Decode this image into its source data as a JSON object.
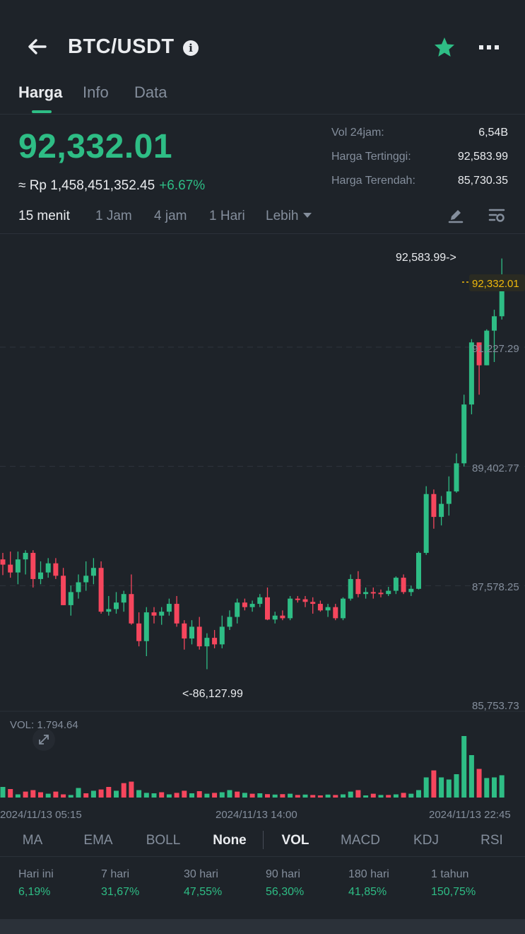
{
  "header": {
    "pair": "BTC/USDT",
    "info_glyph": "i",
    "icons": [
      "back-arrow-icon",
      "info-icon",
      "favorite-star-icon",
      "more-icon"
    ]
  },
  "tabs": [
    {
      "label": "Harga",
      "active": true
    },
    {
      "label": "Info",
      "active": false
    },
    {
      "label": "Data",
      "active": false
    }
  ],
  "ticker": {
    "last_price": "92,332.01",
    "fiat_value": "≈ Rp 1,458,451,352.45",
    "change_pct": "+6.67%",
    "stats": [
      {
        "label": "Vol 24jam:",
        "value": "6,54B"
      },
      {
        "label": "Harga Tertinggi:",
        "value": "92,583.99"
      },
      {
        "label": "Harga Terendah:",
        "value": "85,730.35"
      }
    ]
  },
  "intervals": [
    "15 menit",
    "1 Jam",
    "4 jam",
    "1 Hari",
    "Lebih"
  ],
  "active_interval": "15 menit",
  "chart_data": {
    "type": "candlestick",
    "interval": "15 menit",
    "y_ticks": [
      "91,227.29",
      "89,402.77",
      "87,578.25",
      "85,753.73"
    ],
    "ylim": [
      85753.73,
      92583.99
    ],
    "current_price_label": "92,332.01",
    "high_marker": "92,583.99->",
    "low_marker": "<-86,127.99",
    "volume_label": "VOL: 1,794.64",
    "x_ticks": [
      "2024/11/13 05:15",
      "2024/11/13 14:00",
      "2024/11/13 22:45"
    ],
    "colors": {
      "up": "#2ebd85",
      "down": "#f6465d",
      "current": "#f0b90b"
    },
    "candles": [
      [
        87980,
        88080,
        87740,
        87900
      ],
      [
        87900,
        88100,
        87700,
        87780
      ],
      [
        87780,
        88100,
        87600,
        87980
      ],
      [
        87980,
        88120,
        87750,
        88080
      ],
      [
        88080,
        88120,
        87550,
        87680
      ],
      [
        87680,
        87950,
        87600,
        87780
      ],
      [
        87780,
        88000,
        87700,
        87920
      ],
      [
        87920,
        88000,
        87680,
        87730
      ],
      [
        87730,
        87850,
        87280,
        87280
      ],
      [
        87280,
        87580,
        87120,
        87480
      ],
      [
        87480,
        87750,
        87380,
        87630
      ],
      [
        87630,
        87950,
        87500,
        87730
      ],
      [
        87730,
        88000,
        87600,
        87850
      ],
      [
        87850,
        87950,
        87150,
        87180
      ],
      [
        87180,
        87420,
        87120,
        87220
      ],
      [
        87220,
        87480,
        87150,
        87320
      ],
      [
        87320,
        87500,
        87180,
        87450
      ],
      [
        87450,
        87750,
        86980,
        87000
      ],
      [
        87000,
        87170,
        86650,
        86730
      ],
      [
        86730,
        87250,
        86500,
        87170
      ],
      [
        87170,
        87250,
        87000,
        87120
      ],
      [
        87120,
        87250,
        86980,
        87180
      ],
      [
        87180,
        87380,
        87120,
        87300
      ],
      [
        87300,
        87420,
        86950,
        87000
      ],
      [
        87000,
        87050,
        86600,
        86770
      ],
      [
        86770,
        87050,
        86680,
        86950
      ],
      [
        86950,
        87100,
        86600,
        86650
      ],
      [
        86650,
        86850,
        86300,
        86780
      ],
      [
        86780,
        86900,
        86620,
        86680
      ],
      [
        86680,
        87120,
        86620,
        86950
      ],
      [
        86950,
        87200,
        86900,
        87100
      ],
      [
        87100,
        87380,
        87000,
        87320
      ],
      [
        87320,
        87380,
        87200,
        87250
      ],
      [
        87250,
        87350,
        87180,
        87300
      ],
      [
        87300,
        87450,
        87250,
        87400
      ],
      [
        87400,
        87550,
        87050,
        87060
      ],
      [
        87060,
        87180,
        87000,
        87120
      ],
      [
        87120,
        87200,
        87050,
        87080
      ],
      [
        87080,
        87420,
        87050,
        87380
      ],
      [
        87380,
        87420,
        87320,
        87370
      ],
      [
        87370,
        87420,
        87250,
        87330
      ],
      [
        87330,
        87400,
        87150,
        87300
      ],
      [
        87300,
        87350,
        87180,
        87200
      ],
      [
        87200,
        87300,
        87100,
        87250
      ],
      [
        87250,
        87300,
        87050,
        87080
      ],
      [
        87080,
        87400,
        87050,
        87380
      ],
      [
        87380,
        87750,
        87350,
        87680
      ],
      [
        87680,
        87800,
        87400,
        87450
      ],
      [
        87450,
        87550,
        87380,
        87480
      ],
      [
        87480,
        87550,
        87380,
        87470
      ],
      [
        87470,
        87520,
        87400,
        87450
      ],
      [
        87450,
        87560,
        87420,
        87500
      ],
      [
        87500,
        87720,
        87450,
        87700
      ],
      [
        87700,
        87750,
        87450,
        87480
      ],
      [
        87480,
        87580,
        87420,
        87530
      ],
      [
        87530,
        88100,
        87520,
        88080
      ],
      [
        88080,
        89100,
        88050,
        88980
      ],
      [
        88980,
        89050,
        88450,
        88630
      ],
      [
        88630,
        88950,
        88500,
        88830
      ],
      [
        88830,
        89250,
        88650,
        89020
      ],
      [
        89020,
        89600,
        89000,
        89450
      ],
      [
        89450,
        90500,
        89400,
        90350
      ],
      [
        90350,
        91350,
        90200,
        91300
      ],
      [
        91300,
        91300,
        90500,
        90950
      ],
      [
        90950,
        91500,
        90950,
        91480
      ],
      [
        91480,
        91800,
        91000,
        91700
      ],
      [
        91700,
        92583.99,
        91650,
        92332.01
      ]
    ],
    "volume": [
      50,
      40,
      15,
      28,
      35,
      25,
      18,
      28,
      15,
      12,
      45,
      20,
      32,
      38,
      50,
      32,
      68,
      75,
      35,
      22,
      20,
      25,
      15,
      22,
      32,
      20,
      30,
      18,
      22,
      25,
      35,
      28,
      22,
      18,
      20,
      16,
      14,
      16,
      18,
      12,
      14,
      12,
      10,
      14,
      12,
      15,
      28,
      35,
      10,
      18,
      12,
      12,
      15,
      22,
      18,
      35,
      95,
      128,
      95,
      85,
      110,
      290,
      200,
      135,
      92,
      95,
      105
    ],
    "volume_colors_down": [
      false,
      true,
      false,
      true,
      true,
      true,
      false,
      true,
      true,
      false,
      false,
      true,
      false,
      true,
      true,
      false,
      true,
      true,
      false,
      false,
      false,
      true,
      false,
      true,
      true,
      false,
      true,
      false,
      true,
      false,
      false,
      true,
      false,
      true,
      false,
      true,
      false,
      true,
      false,
      true,
      false,
      true,
      true,
      false,
      true,
      false,
      false,
      true,
      false,
      true,
      false,
      true,
      false,
      true,
      false,
      false,
      false,
      true,
      false,
      false,
      false,
      false,
      false,
      true,
      false,
      false,
      false
    ]
  },
  "indicators": [
    "MA",
    "EMA",
    "BOLL",
    "None",
    "VOL",
    "MACD",
    "KDJ",
    "RSI"
  ],
  "active_indicators": [
    "None",
    "VOL"
  ],
  "performance": [
    {
      "label": "Hari ini",
      "value": "6,19%"
    },
    {
      "label": "7 hari",
      "value": "31,67%"
    },
    {
      "label": "30 hari",
      "value": "47,55%"
    },
    {
      "label": "90 hari",
      "value": "56,30%"
    },
    {
      "label": "180 hari",
      "value": "41,85%"
    },
    {
      "label": "1 tahun",
      "value": "150,75%"
    }
  ]
}
